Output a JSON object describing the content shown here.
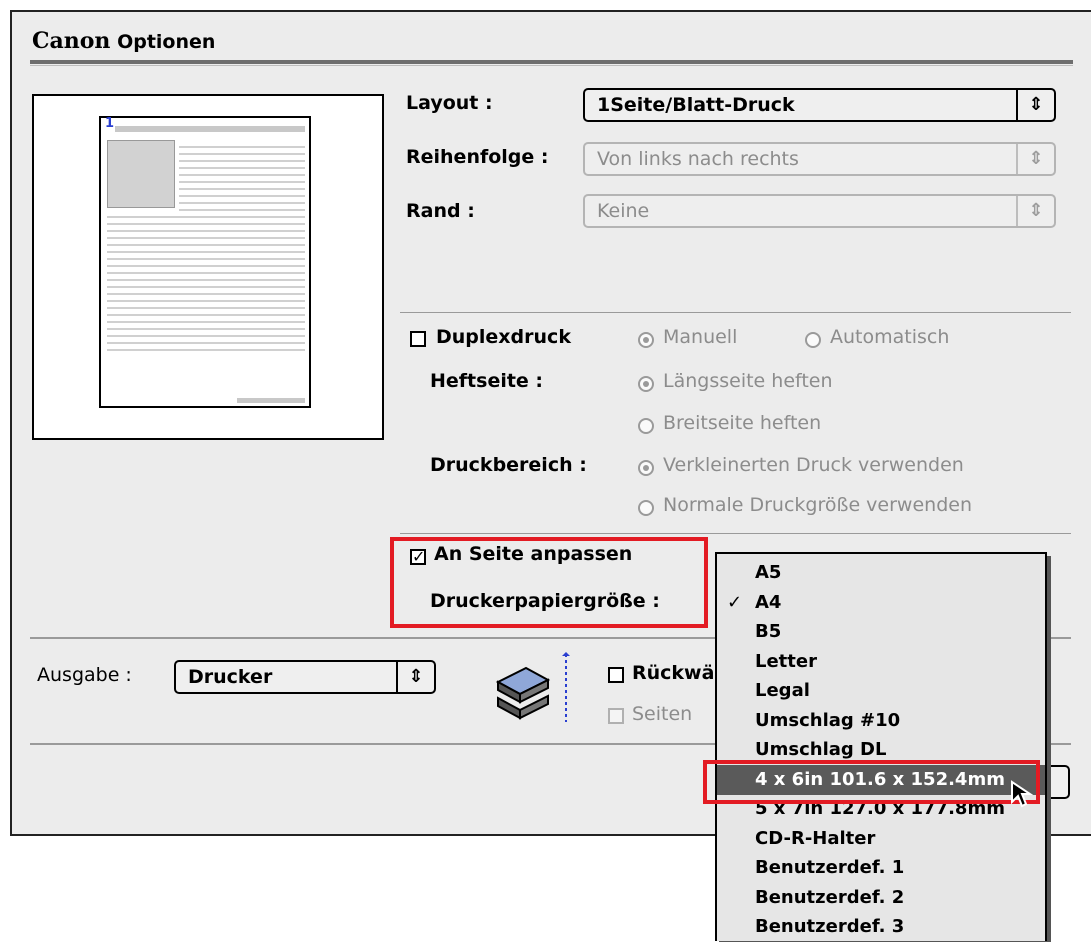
{
  "title": {
    "brand": "Canon",
    "text": "Optionen"
  },
  "layout": {
    "label": "Layout :",
    "value": "1Seite/Blatt-Druck",
    "order_label": "Reihenfolge :",
    "order_value": "Von links nach rechts",
    "border_label": "Rand :",
    "border_value": "Keine"
  },
  "preview": {
    "page_number": "1"
  },
  "duplex": {
    "label": "Duplexdruck",
    "checked": false,
    "manual": "Manuell",
    "automatic": "Automatisch",
    "binding_label": "Heftseite :",
    "long_edge": "Längsseite heften",
    "short_edge": "Breitseite heften",
    "area_label": "Druckbereich :",
    "reduced": "Verkleinerten Druck verwenden",
    "normal": "Normale Druckgröße verwenden"
  },
  "fit": {
    "label": "An Seite anpassen",
    "checked": true,
    "paper_size_label": "Druckerpapiergröße :"
  },
  "output": {
    "label": "Ausgabe :",
    "value": "Drucker",
    "reverse_label": "Rückwä",
    "pages_label": "Seiten"
  },
  "paper_menu": {
    "items": [
      "A5",
      "A4",
      "B5",
      "Letter",
      "Legal",
      "Umschlag #10",
      "Umschlag DL",
      "4 x 6in  101.6 x 152.4mm",
      "5 x 7in  127.0 x 177.8mm",
      "CD-R-Halter",
      "Benutzerdef. 1",
      "Benutzerdef. 2",
      "Benutzerdef. 3"
    ],
    "checked_index": 1,
    "highlighted_index": 7
  },
  "colors": {
    "highlight_box": "#e31b23",
    "menu_selection": "#5a5a5a"
  }
}
